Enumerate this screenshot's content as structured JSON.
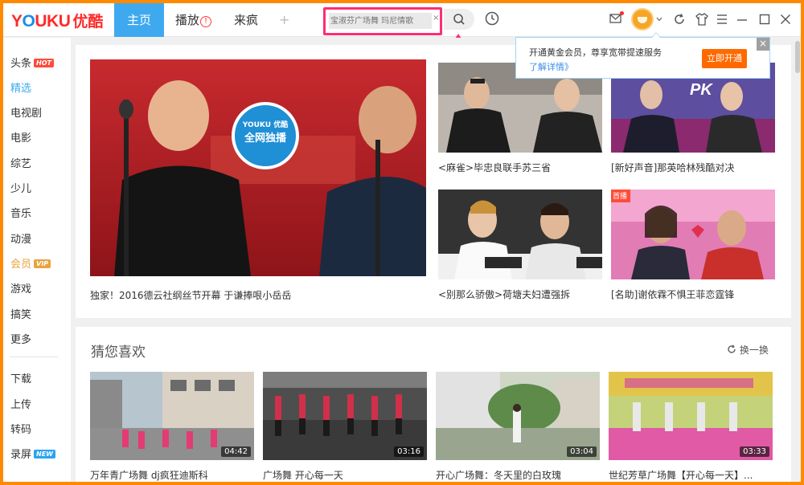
{
  "logo": {
    "brand": "YOUKU",
    "cn": "优酷"
  },
  "nav": {
    "tabs": [
      {
        "label": "主页"
      },
      {
        "label": "播放",
        "badge": "!"
      },
      {
        "label": "来疯"
      }
    ],
    "add": "+"
  },
  "search": {
    "placeholder": "宝淑芬广场舞 玛尼情歌",
    "clear": "×"
  },
  "popup": {
    "text": "开通黄金会员，尊享宽带提速服务",
    "link": "了解详情》",
    "button": "立即开通",
    "close": "×"
  },
  "sidebar": {
    "items": [
      {
        "label": "头条",
        "tag": "HOT"
      },
      {
        "label": "精选"
      },
      {
        "label": "电视剧"
      },
      {
        "label": "电影"
      },
      {
        "label": "综艺"
      },
      {
        "label": "少儿"
      },
      {
        "label": "音乐"
      },
      {
        "label": "动漫"
      },
      {
        "label": "会员",
        "tag": "VIP"
      },
      {
        "label": "游戏"
      },
      {
        "label": "搞笑"
      },
      {
        "label": "更多"
      }
    ],
    "tools": [
      {
        "label": "下载"
      },
      {
        "label": "上传"
      },
      {
        "label": "转码"
      },
      {
        "label": "录屏",
        "tag": "NEW"
      }
    ]
  },
  "featured": {
    "main_caption": "独家！2016德云社纲丝节开幕 于谦捧哏小岳岳",
    "stamp": {
      "brand": "YOUKU 优酷",
      "label": "全网独播"
    },
    "items": [
      {
        "caption": "<麻雀>毕忠良联手苏三省"
      },
      {
        "caption": "[新好声音]那英哈林残酷对决"
      },
      {
        "caption": "<别那么骄傲>荷塘夫妇遭强拆"
      },
      {
        "caption": "[名助]谢依霖不惧王菲恋霆锋",
        "corner": "首播"
      }
    ]
  },
  "recommend": {
    "title": "猜您喜欢",
    "refresh": "换一换",
    "items": [
      {
        "caption": "万年青广场舞 dj疯狂迪斯科",
        "duration": "04:42"
      },
      {
        "caption": "广场舞 开心每一天",
        "duration": "03:16"
      },
      {
        "caption": "开心广场舞：冬天里的白玫瑰",
        "duration": "03:04"
      },
      {
        "caption": "世纪芳草广场舞【开心每一天】...",
        "duration": "03:33"
      }
    ]
  },
  "colors": {
    "window_border": "#ff8a00",
    "nav_active": "#3fa9ef",
    "brand_red": "#ff2a2a",
    "highlight": "#ff2d73",
    "vip": "#e8a33d",
    "popup_button": "#ff6a00"
  }
}
